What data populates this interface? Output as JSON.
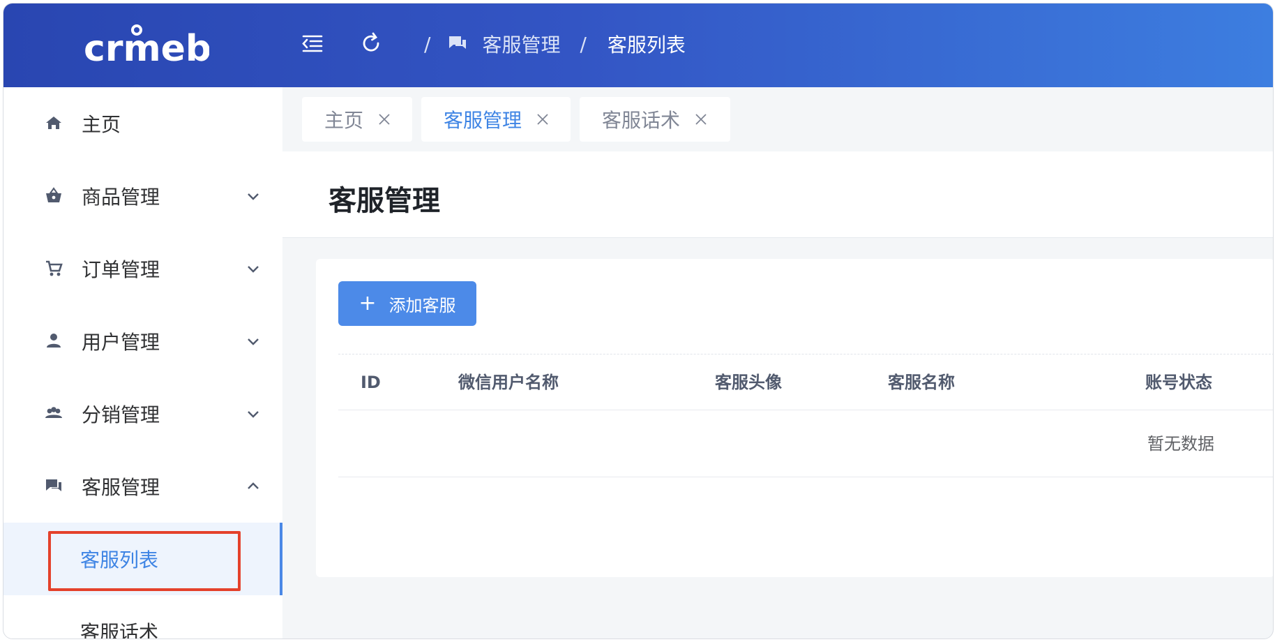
{
  "header": {
    "logo_text": "crmeb",
    "breadcrumb": [
      "/",
      "客服管理",
      "/",
      "客服列表"
    ]
  },
  "sidebar": {
    "items": [
      {
        "label": "主页",
        "icon": "home-icon"
      },
      {
        "label": "商品管理",
        "icon": "basket-icon"
      },
      {
        "label": "订单管理",
        "icon": "cart-icon"
      },
      {
        "label": "用户管理",
        "icon": "user-icon"
      },
      {
        "label": "分销管理",
        "icon": "group-icon"
      },
      {
        "label": "客服管理",
        "icon": "chat-icon"
      }
    ],
    "sub_items": [
      {
        "label": "客服列表",
        "active": true
      },
      {
        "label": "客服话术",
        "active": false
      }
    ]
  },
  "tabs": [
    {
      "label": "主页",
      "active": false
    },
    {
      "label": "客服管理",
      "active": true
    },
    {
      "label": "客服话术",
      "active": false
    }
  ],
  "page": {
    "title": "客服管理",
    "add_button": "添加客服",
    "add_button_icon": "+"
  },
  "table": {
    "columns": [
      "ID",
      "微信用户名称",
      "客服头像",
      "客服名称",
      "账号状态"
    ],
    "empty_text": "暂无数据"
  },
  "colors": {
    "accent": "#4c8ae8",
    "header_gradient_start": "#2946b1",
    "header_gradient_end": "#3d7ee0",
    "highlight_box": "#e4412b"
  }
}
